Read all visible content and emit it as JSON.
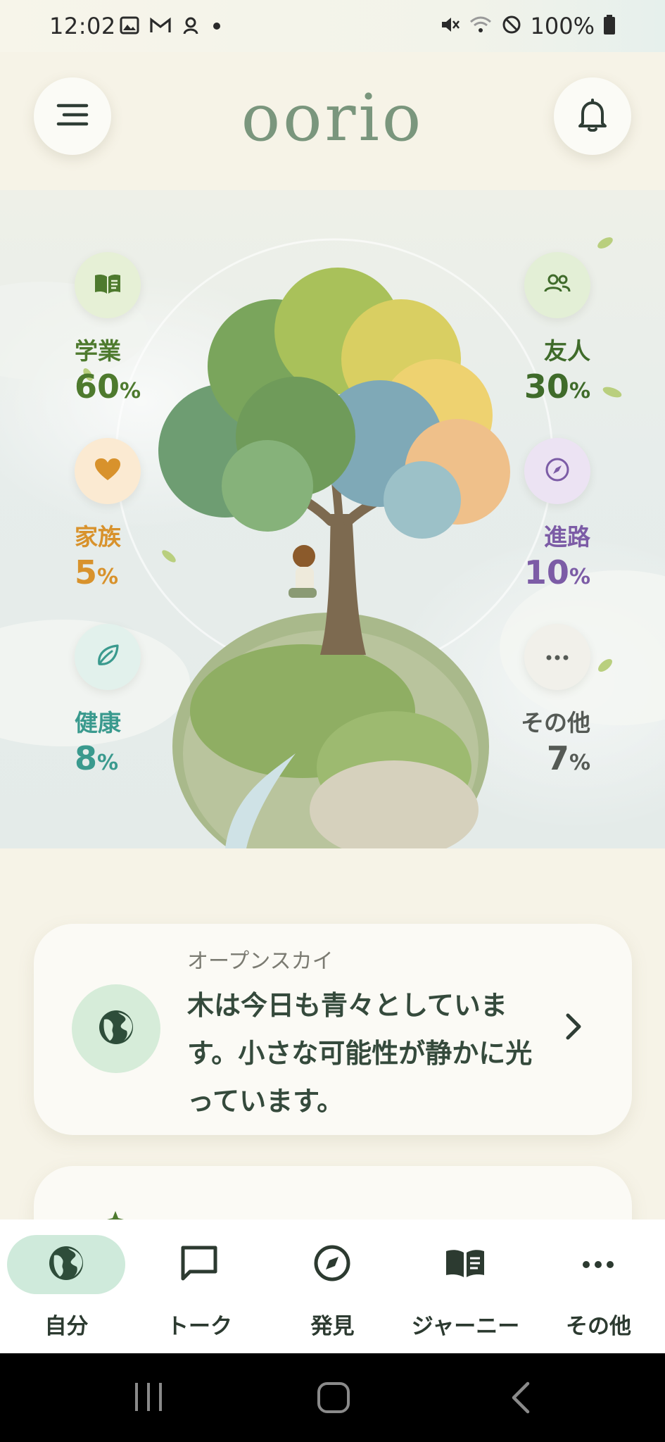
{
  "status_bar": {
    "time": "12:02",
    "battery": "100%",
    "icons": [
      "image-icon",
      "gmail-icon",
      "fingerprint-app-icon",
      "notification-dot-icon",
      "mute-icon",
      "wifi-icon",
      "do-not-disturb-icon",
      "battery-icon"
    ]
  },
  "header": {
    "title": "oorio",
    "menu_icon": "menu-icon",
    "bell_icon": "bell-icon"
  },
  "stats": {
    "study": {
      "label": "学業",
      "value": "60",
      "unit": "%",
      "icon": "book-icon",
      "color": "#4e7a2e",
      "bg": "#e6f0d6"
    },
    "friends": {
      "label": "友人",
      "value": "30",
      "unit": "%",
      "icon": "people-icon",
      "color": "#3f6b2a",
      "bg": "#e3efd6"
    },
    "family": {
      "label": "家族",
      "value": "5",
      "unit": "%",
      "icon": "heart-icon",
      "color": "#d8922c",
      "bg": "#fbead2"
    },
    "career": {
      "label": "進路",
      "value": "10",
      "unit": "%",
      "icon": "compass-icon",
      "color": "#7c5ca6",
      "bg": "#ece3f3"
    },
    "health": {
      "label": "健康",
      "value": "8",
      "unit": "%",
      "icon": "leaf-icon",
      "color": "#3a9a8e",
      "bg": "#e2f1ec"
    },
    "other": {
      "label": "その他",
      "value": "7",
      "unit": "%",
      "icon": "more-icon",
      "color": "#555a55",
      "bg": "#f1f0ea"
    }
  },
  "open_sky_card": {
    "title": "オープンスカイ",
    "message": "木は今日も青々としています。小さな可能性が静かに光っています。",
    "icon": "globe-icon",
    "chevron": "chevron-right-icon"
  },
  "bottom_nav": {
    "items": [
      {
        "label": "自分",
        "icon": "globe-icon",
        "active": true
      },
      {
        "label": "トーク",
        "icon": "chat-icon",
        "active": false
      },
      {
        "label": "発見",
        "icon": "compass-icon",
        "active": false
      },
      {
        "label": "ジャーニー",
        "icon": "book-open-icon",
        "active": false
      },
      {
        "label": "その他",
        "icon": "more-icon",
        "active": false
      }
    ]
  },
  "colors": {
    "accent_green": "#7a967d",
    "background": "#f6f3e7",
    "active_nav": "#cfeadb"
  }
}
